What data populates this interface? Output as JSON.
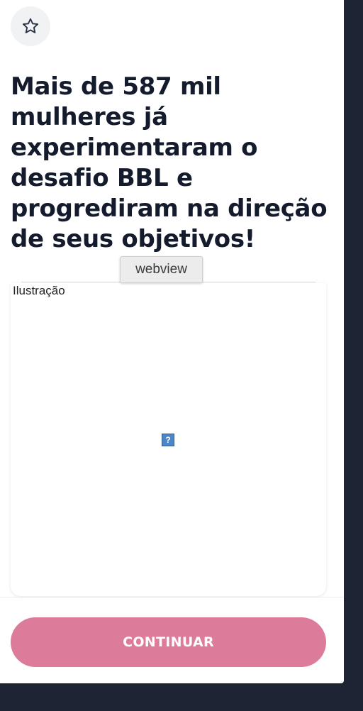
{
  "header": {
    "favorite_icon": "star-outline-icon"
  },
  "main": {
    "headline": "Mais de 587 mil mulheres já experimentaram o desafio BBL e progrediram na direção de seus objetivos!",
    "tooltip": "webview",
    "illustration": {
      "alt_text": "Ilustração",
      "broken_image_glyph": "?"
    }
  },
  "footer": {
    "continue_label": "CONTINUAR"
  },
  "colors": {
    "accent": "#dd7b9a",
    "text": "#141b2d",
    "frame": "#1f2434"
  }
}
